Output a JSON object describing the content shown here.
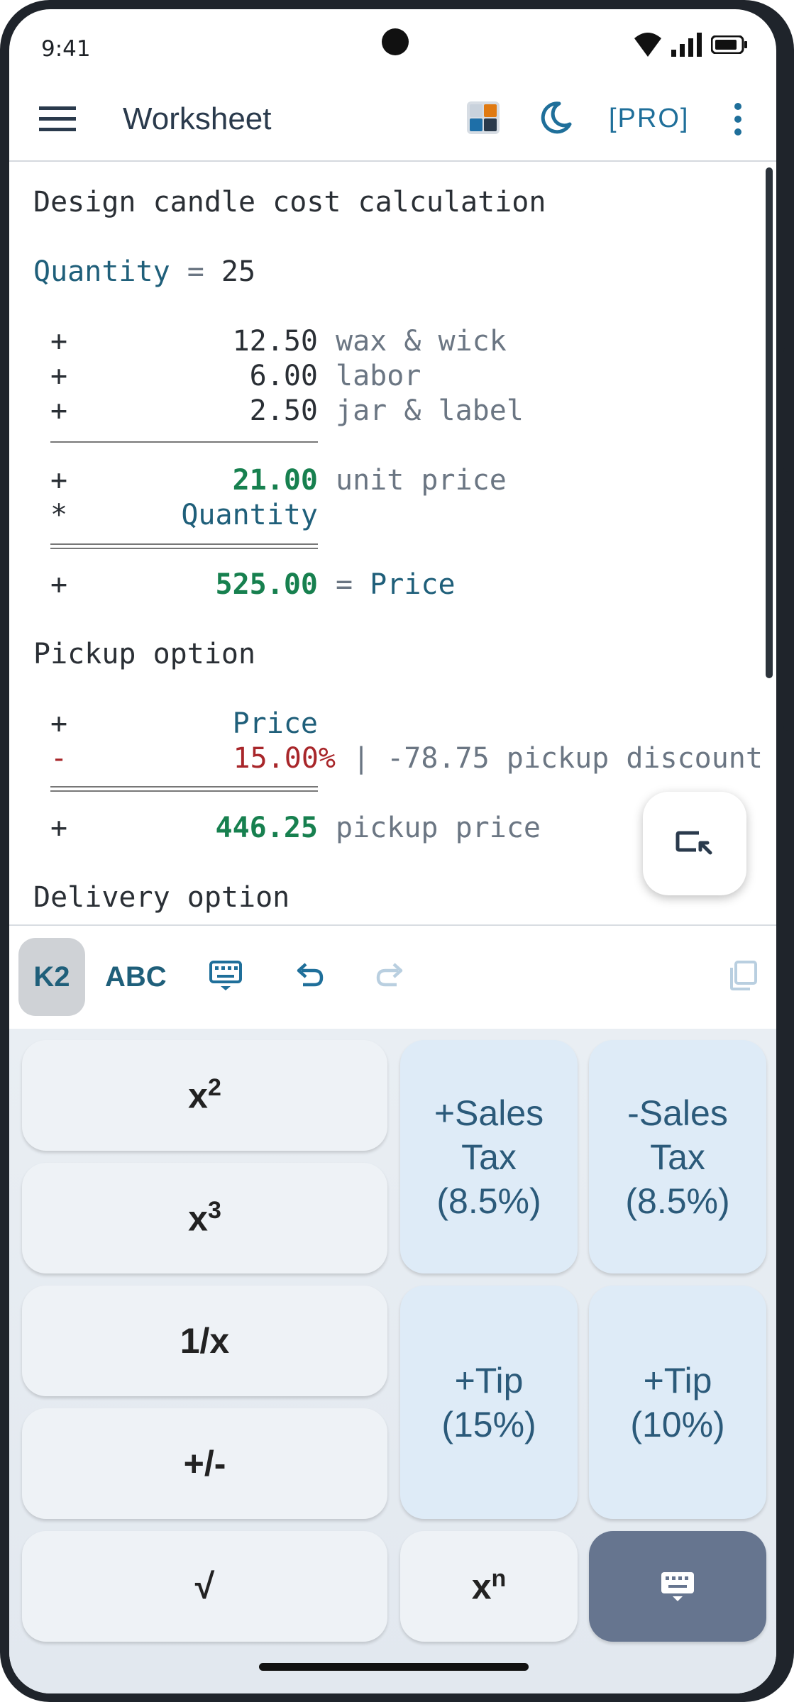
{
  "status_bar": {
    "time": "9:41"
  },
  "app_bar": {
    "title": "Worksheet",
    "pro_label": "[PRO]"
  },
  "worksheet": {
    "heading": "Design candle cost calculation",
    "quantity_var": "Quantity",
    "quantity_eq": " = ",
    "quantity_value": "25",
    "items": [
      {
        "op": "+",
        "value": "12.50",
        "comment": "wax & wick"
      },
      {
        "op": "+",
        "value": "6.00",
        "comment": "labor"
      },
      {
        "op": "+",
        "value": "2.50",
        "comment": "jar & label"
      }
    ],
    "unit_line": {
      "op": "+",
      "value": "21.00",
      "comment": "unit price"
    },
    "multiply_line": {
      "op": "*",
      "value": "Quantity"
    },
    "price_line": {
      "op": "+",
      "value": "525.00",
      "eq": "= ",
      "var": "Price"
    },
    "pickup_heading": "Pickup option",
    "pickup_price_line": {
      "op": "+",
      "value": "Price"
    },
    "pickup_discount_line": {
      "op": "-",
      "value": "15.00%",
      "comment": "| -78.75 pickup discount"
    },
    "pickup_result_line": {
      "op": "+",
      "value": "446.25",
      "comment": "pickup price"
    },
    "delivery_heading": "Delivery option"
  },
  "toolbar": {
    "k2_label": "K2",
    "abc_label": "ABC"
  },
  "keypad": {
    "x_squared": {
      "base": "x",
      "exp": "2"
    },
    "x_cubed": {
      "base": "x",
      "exp": "3"
    },
    "reciprocal": "1/x",
    "negate": "+/-",
    "sqrt": "√",
    "x_power_n": {
      "base": "x",
      "exp": "n"
    },
    "plus_sales_tax": {
      "line1": "+Sales",
      "line2": "Tax",
      "line3": "(8.5%)"
    },
    "minus_sales_tax": {
      "line1": "-Sales",
      "line2": "Tax",
      "line3": "(8.5%)"
    },
    "tip_15": {
      "line1": "+Tip",
      "line2": "(15%)"
    },
    "tip_10": {
      "line1": "+Tip",
      "line2": "(10%)"
    }
  },
  "colors": {
    "accent": "#1f6f9a",
    "result_green": "#17804f",
    "negative_red": "#a8262a",
    "keypad_key": "#eef2f6",
    "keypad_key_blue": "#deebf7",
    "keyboard_key": "#66758f"
  }
}
